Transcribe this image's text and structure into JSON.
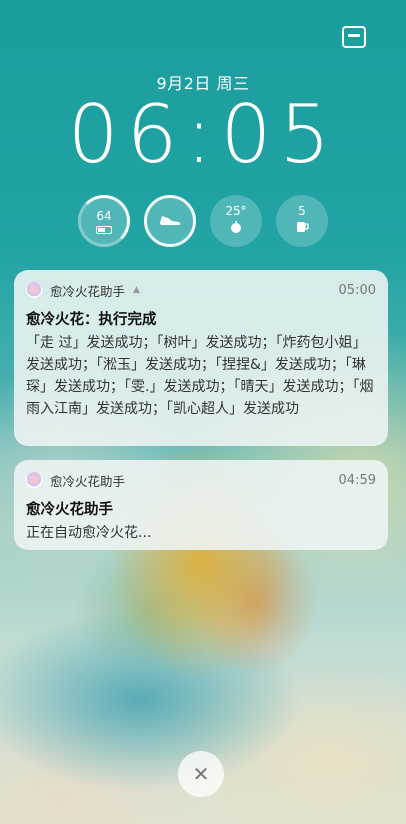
{
  "lockscreen": {
    "date": "9月2日 周三",
    "time": "06:05"
  },
  "widgets": {
    "battery": {
      "value": "64",
      "icon": "battery-icon"
    },
    "steps": {
      "icon": "shoe-icon"
    },
    "weather": {
      "value": "25°",
      "icon": "apple-icon"
    },
    "water": {
      "value": "5",
      "icon": "cup-icon"
    }
  },
  "notifications": [
    {
      "app_name": "愈冷火花助手",
      "time": "05:00",
      "title": "愈冷火花：执行完成",
      "body": "「走 过」发送成功；「树叶」发送成功；「炸药包小姐」发送成功；「淞玉」发送成功；「捏捏&」发送成功；「琳琛」发送成功；「雯.」发送成功；「晴天」发送成功；「烟雨入江南」发送成功；「凯心超人」发送成功"
    },
    {
      "app_name": "愈冷火花助手",
      "time": "04:59",
      "title": "愈冷火花助手",
      "body": "正在自动愈冷火花..."
    }
  ],
  "close_button": {
    "icon": "close-icon",
    "label": "✕"
  }
}
